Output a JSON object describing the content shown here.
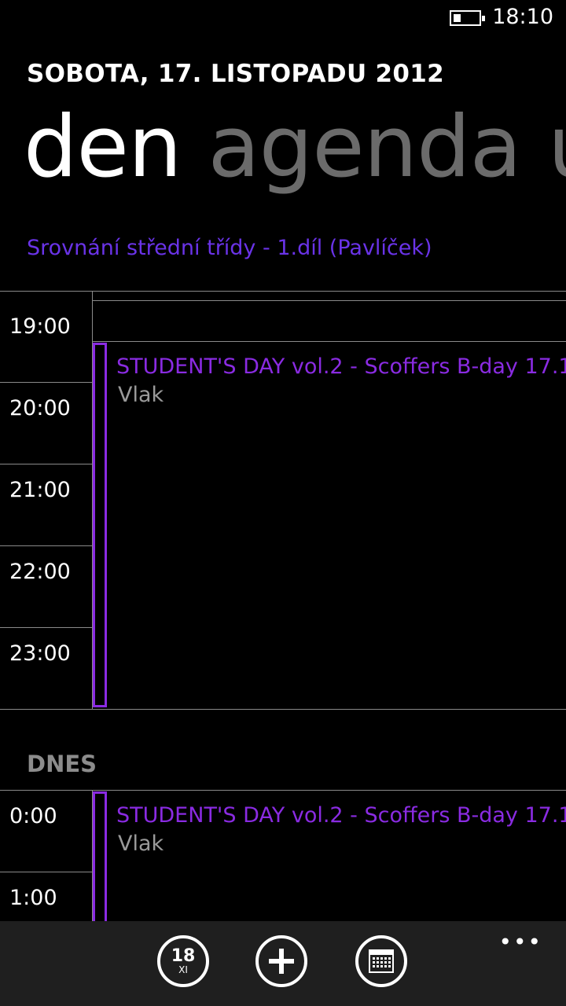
{
  "status_bar": {
    "time": "18:10",
    "battery": "low"
  },
  "header": {
    "date": "SOBOTA, 17. LISTOPADU 2012",
    "pivots": [
      {
        "label": "den",
        "active": true
      },
      {
        "label": "agenda",
        "active": false
      },
      {
        "label": "úk",
        "active": false
      }
    ]
  },
  "all_day_event": "Srovnání střední třídy - 1.díl (Pavlíček)",
  "day1": {
    "hours": [
      "19:00",
      "20:00",
      "21:00",
      "22:00",
      "23:00"
    ],
    "event": {
      "title": "STUDENT'S DAY vol.2 - Scoffers B-day 17.1",
      "location": "Vlak"
    }
  },
  "day2": {
    "label": "DNES",
    "hours": [
      "0:00",
      "1:00"
    ],
    "event": {
      "title": "STUDENT'S DAY vol.2 - Scoffers B-day 17.1",
      "location": "Vlak"
    }
  },
  "app_bar": {
    "today_button": {
      "day": "18",
      "month": "XI",
      "icon": "today-icon"
    },
    "add_button": {
      "icon": "add-icon"
    },
    "calendar_button": {
      "icon": "calendar-icon"
    },
    "more": "•••"
  },
  "colors": {
    "accent": "#8a2be2",
    "allday": "#6a33e8",
    "inactive": "#6b6b6b"
  }
}
